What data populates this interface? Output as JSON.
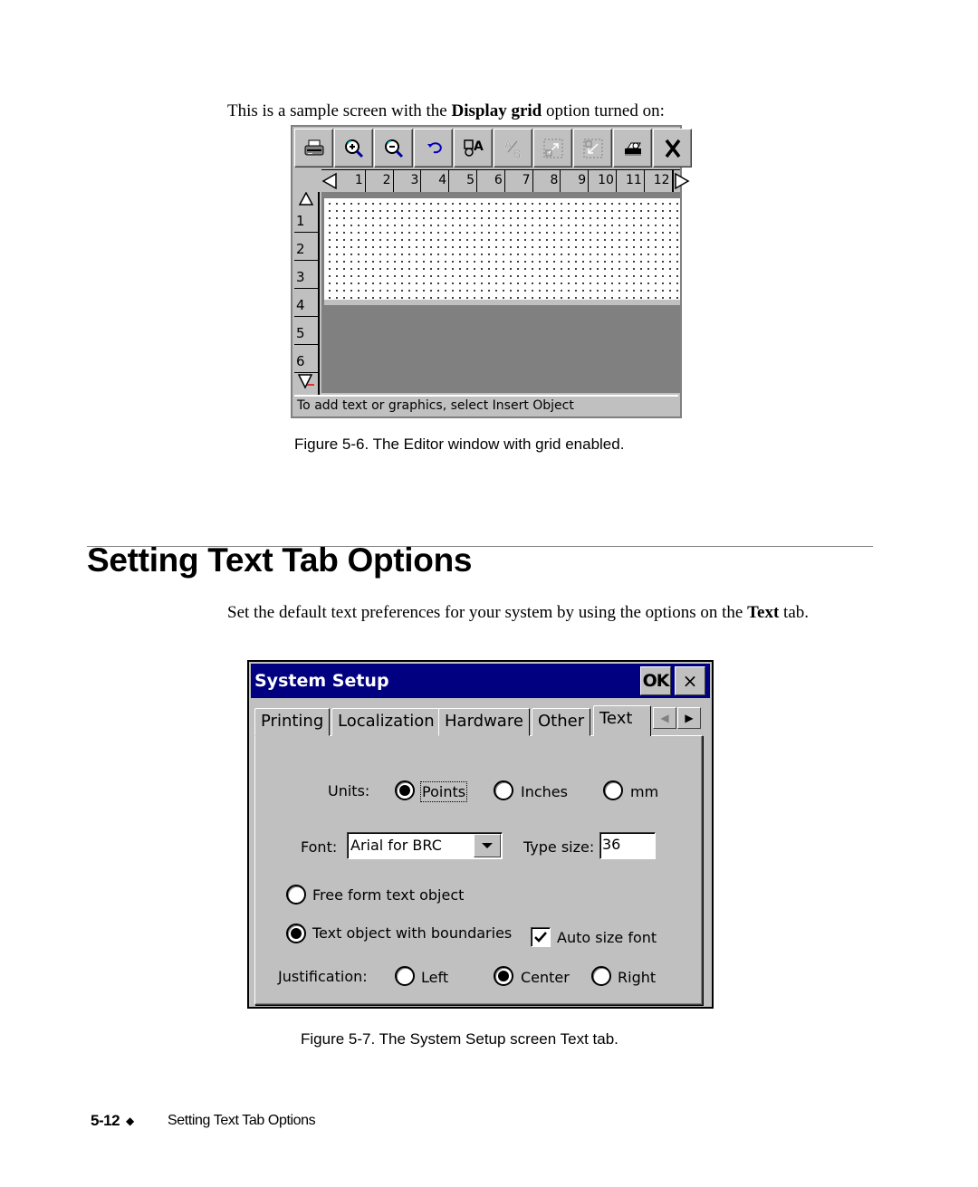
{
  "intro": {
    "pre": "This is a sample screen with the ",
    "bold": "Display grid",
    "post": " option turned on:"
  },
  "editor": {
    "toolbar": [
      {
        "icon": "print-icon",
        "enabled": true
      },
      {
        "icon": "zoom-in-icon",
        "enabled": true
      },
      {
        "icon": "zoom-out-icon",
        "enabled": true
      },
      {
        "icon": "undo-icon",
        "enabled": true
      },
      {
        "icon": "insert-object-icon",
        "enabled": true
      },
      {
        "icon": "text-properties-icon",
        "enabled": false
      },
      {
        "icon": "resize-object-icon",
        "enabled": false
      },
      {
        "icon": "move-object-icon",
        "enabled": false
      },
      {
        "icon": "print-preview-icon",
        "enabled": true
      },
      {
        "icon": "close-icon",
        "enabled": true
      }
    ],
    "horizontal_ruler": [
      "1",
      "2",
      "3",
      "4",
      "5",
      "6",
      "7",
      "8",
      "9",
      "10",
      "11",
      "12"
    ],
    "vertical_ruler": [
      "1",
      "2",
      "3",
      "4",
      "5",
      "6"
    ],
    "status": "To add text or graphics, select Insert Object",
    "grid_enabled": true
  },
  "caption1": "Figure 5-6. The Editor window with grid enabled.",
  "heading": "Setting Text Tab Options",
  "body": {
    "pre": "Set the default text preferences for your system by using the options on the ",
    "bold": "Text",
    "post": " tab."
  },
  "dialog": {
    "title": "System Setup",
    "ok_label": "OK",
    "close_label": "×",
    "tabs": [
      "Printing",
      "Localization",
      "Hardware",
      "Other",
      "Text"
    ],
    "active_tab": "Text",
    "units_label": "Units:",
    "units_options": [
      "Points",
      "Inches",
      "mm"
    ],
    "units_selected": "Points",
    "font_label": "Font:",
    "font_value": "Arial for BRC",
    "type_size_label": "Type size:",
    "type_size_value": "36",
    "object_options": [
      "Free form text object",
      "Text object with boundaries"
    ],
    "object_selected": "Text object with boundaries",
    "auto_size_label": "Auto size font",
    "auto_size_checked": true,
    "justification_label": "Justification:",
    "justification_options": [
      "Left",
      "Center",
      "Right"
    ],
    "justification_selected": "Center"
  },
  "caption2": "Figure 5-7. The System Setup screen Text tab.",
  "footer": {
    "page_number": "5-12",
    "section_title": "Setting Text Tab Options"
  }
}
